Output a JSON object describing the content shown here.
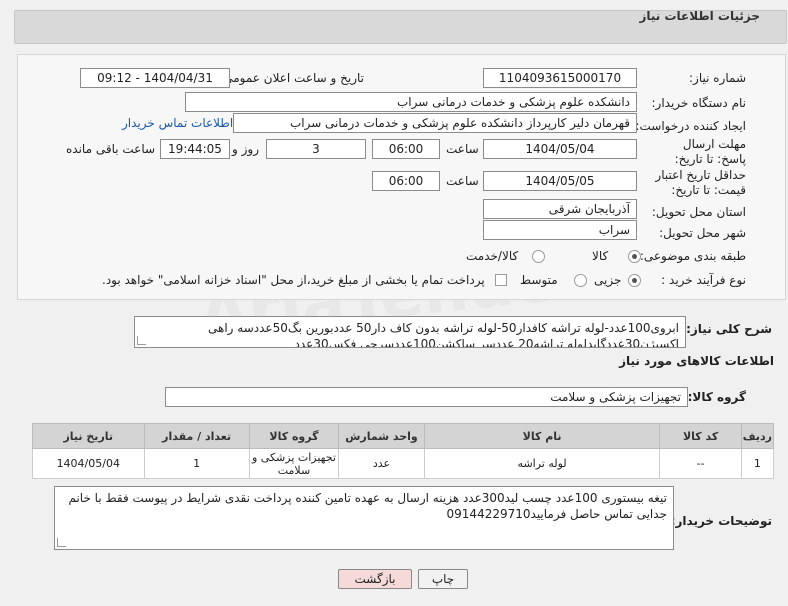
{
  "header": {
    "title": "جزئیات اطلاعات نیاز"
  },
  "form": {
    "need_number_label": "شماره نیاز:",
    "need_number": "1104093615000170",
    "announce_label": "تاریخ و ساعت اعلان عمومی:",
    "announce_value": "1404/04/31 - 09:12",
    "buyer_org_label": "نام دستگاه خریدار:",
    "buyer_org": "دانشکده علوم پزشکی و خدمات درمانی سراب",
    "requester_label": "ایجاد کننده درخواست:",
    "requester": "قهرمان دلیر کارپرداز دانشکده علوم پزشکی و خدمات درمانی سراب",
    "contact_link": "اطلاعات تماس خریدار",
    "deadline_label": "مهلت ارسال پاسخ: تا تاریخ:",
    "deadline_date": "1404/05/04",
    "time_label": "ساعت",
    "deadline_time": "06:00",
    "days_label": "روز و",
    "days_value": "3",
    "remaining_time": "19:44:05",
    "remaining_label": "ساعت باقی مانده",
    "validity_label": "حداقل تاریخ اعتبار قیمت: تا تاریخ:",
    "validity_date": "1404/05/05",
    "validity_time": "06:00",
    "province_label": "استان محل تحویل:",
    "province": "آذربایجان شرقی",
    "city_label": "شهر محل تحویل:",
    "city": "سراب",
    "category_label": "طبقه بندی موضوعی:",
    "category_options": [
      "کالا",
      "کالا/خدمت"
    ],
    "process_label": "نوع فرآیند خرید :",
    "process_options": [
      "جزیی",
      "متوسط"
    ],
    "payment_note": "پرداخت تمام یا بخشی از مبلغ خرید،از محل \"اسناد خزانه اسلامی\" خواهد بود."
  },
  "description": {
    "label": "شرح کلی نیاز:",
    "text": "ابروی100عدد-لوله تراشه کافدار50-لوله تراشه بدون کاف دار50 عددبورین بگ50عددسه راهی اکسیژن30عددگایدلوله تراشه20 عددسر ساکشن100عددسرجی فکس30عدد"
  },
  "goods": {
    "section_title": "اطلاعات کالاهای مورد نیاز",
    "group_label": "گروه کالا:",
    "group_value": "تجهیزات پزشکی و سلامت",
    "columns": [
      "ردیف",
      "کد کالا",
      "نام کالا",
      "واحد شمارش",
      "گروه کالا",
      "تعداد / مقدار",
      "تاریخ نیاز"
    ],
    "rows": [
      {
        "row": "1",
        "code": "--",
        "name": "لوله تراشه",
        "unit": "عدد",
        "group": "تجهیزات پزشکی و سلامت",
        "qty": "1",
        "date": "1404/05/04"
      }
    ]
  },
  "buyer_notes": {
    "label": "توضیحات خریدار:",
    "text": "تیغه بیستوری 100عدد چسب لید300عدد هزینه ارسال به عهده تامین کننده پرداخت نقدی شرایط در پیوست فقط با خانم جدایی تماس حاصل فرمایید09144229710"
  },
  "buttons": {
    "print": "چاپ",
    "back": "بازگشت"
  },
  "colors": {
    "link": "#1a5aa8",
    "back_button_bg": "#f6dada",
    "header_bg": "#d9d9d9"
  }
}
